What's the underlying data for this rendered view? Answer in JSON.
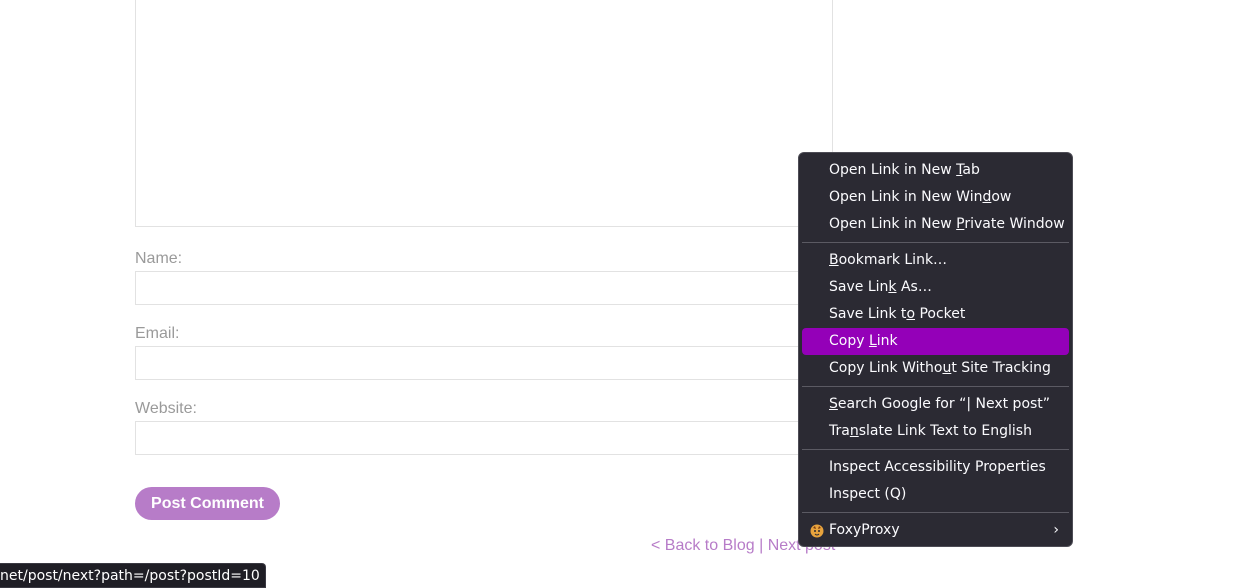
{
  "form": {
    "name_label": "Name:",
    "email_label": "Email:",
    "website_label": "Website:",
    "submit_label": "Post Comment"
  },
  "nav": {
    "back_label": "< Back to Blog",
    "separator": "|",
    "next_label": "Next post"
  },
  "status_bar": {
    "url": "net/post/next?path=/post?postId=10"
  },
  "context_menu": {
    "items": [
      {
        "pre": "Open Link in New ",
        "key": "T",
        "post": "ab"
      },
      {
        "pre": "Open Link in New Win",
        "key": "d",
        "post": "ow"
      },
      {
        "pre": "Open Link in New ",
        "key": "P",
        "post": "rivate Window"
      },
      {
        "pre": "",
        "key": "B",
        "post": "ookmark Link…"
      },
      {
        "pre": "Save Lin",
        "key": "k",
        "post": " As…"
      },
      {
        "pre": "Save Link t",
        "key": "o",
        "post": " Pocket"
      },
      {
        "pre": "Copy ",
        "key": "L",
        "post": "ink"
      },
      {
        "pre": "Copy Link Witho",
        "key": "u",
        "post": "t Site Tracking"
      },
      {
        "pre": "",
        "key": "S",
        "post": "earch Google for “| Next post”"
      },
      {
        "pre": "Tra",
        "key": "n",
        "post": "slate Link Text to English"
      },
      {
        "pre": "Inspect Accessibility Properties",
        "key": "",
        "post": ""
      },
      {
        "pre": "Inspect (Q)",
        "key": "",
        "post": ""
      },
      {
        "pre": "FoxyProxy",
        "key": "",
        "post": ""
      }
    ],
    "submenu_chevron": "›",
    "highlight_color": "#9400b8"
  }
}
